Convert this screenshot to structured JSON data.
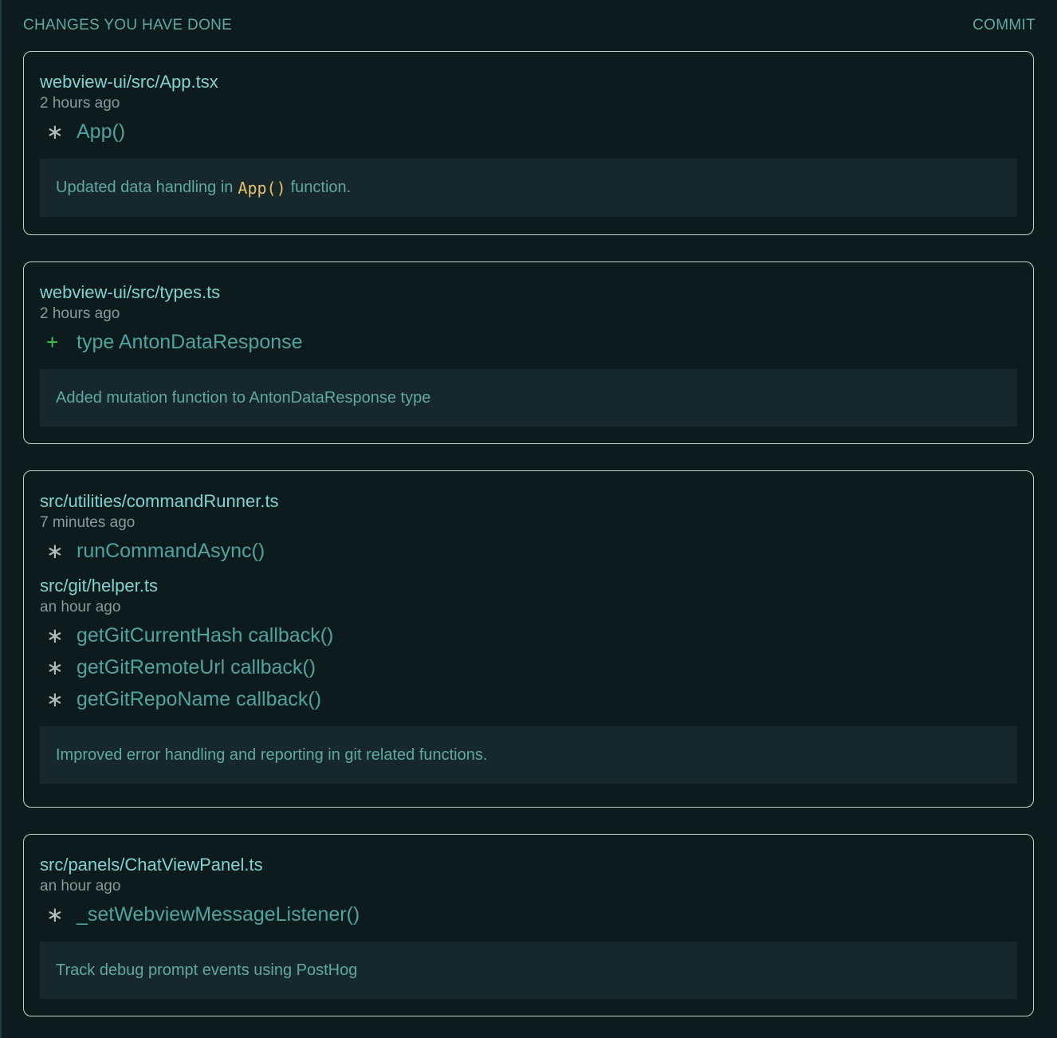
{
  "header": {
    "title": "CHANGES YOU HAVE DONE",
    "commit_label": "COMMIT"
  },
  "cards": [
    {
      "files": [
        {
          "path": "webview-ui/src/App.tsx",
          "time": "2 hours ago",
          "symbols": [
            {
              "marker": "∗",
              "kind": "modified",
              "name": "App()"
            }
          ]
        }
      ],
      "summary": {
        "before": "Updated data handling in",
        "code": "App()",
        "after": "function."
      }
    },
    {
      "files": [
        {
          "path": "webview-ui/src/types.ts",
          "time": "2 hours ago",
          "symbols": [
            {
              "marker": "+",
              "kind": "added",
              "name": "type AntonDataResponse"
            }
          ]
        }
      ],
      "summary": {
        "before": "Added mutation function to AntonDataResponse type",
        "code": "",
        "after": ""
      }
    },
    {
      "files": [
        {
          "path": "src/utilities/commandRunner.ts",
          "time": "7 minutes ago",
          "symbols": [
            {
              "marker": "∗",
              "kind": "modified",
              "name": "runCommandAsync()"
            }
          ]
        },
        {
          "path": "src/git/helper.ts",
          "time": "an hour ago",
          "symbols": [
            {
              "marker": "∗",
              "kind": "modified",
              "name": "getGitCurrentHash callback()"
            },
            {
              "marker": "∗",
              "kind": "modified",
              "name": "getGitRemoteUrl callback()"
            },
            {
              "marker": "∗",
              "kind": "modified",
              "name": "getGitRepoName callback()"
            }
          ]
        }
      ],
      "summary": {
        "before": "Improved error handling and reporting in git related functions.",
        "code": "",
        "after": ""
      }
    },
    {
      "files": [
        {
          "path": "src/panels/ChatViewPanel.ts",
          "time": "an hour ago",
          "symbols": [
            {
              "marker": "∗",
              "kind": "modified",
              "name": "_setWebviewMessageListener()"
            }
          ]
        }
      ],
      "summary": {
        "before": "Track debug prompt events using PostHog",
        "code": "",
        "after": ""
      }
    }
  ]
}
